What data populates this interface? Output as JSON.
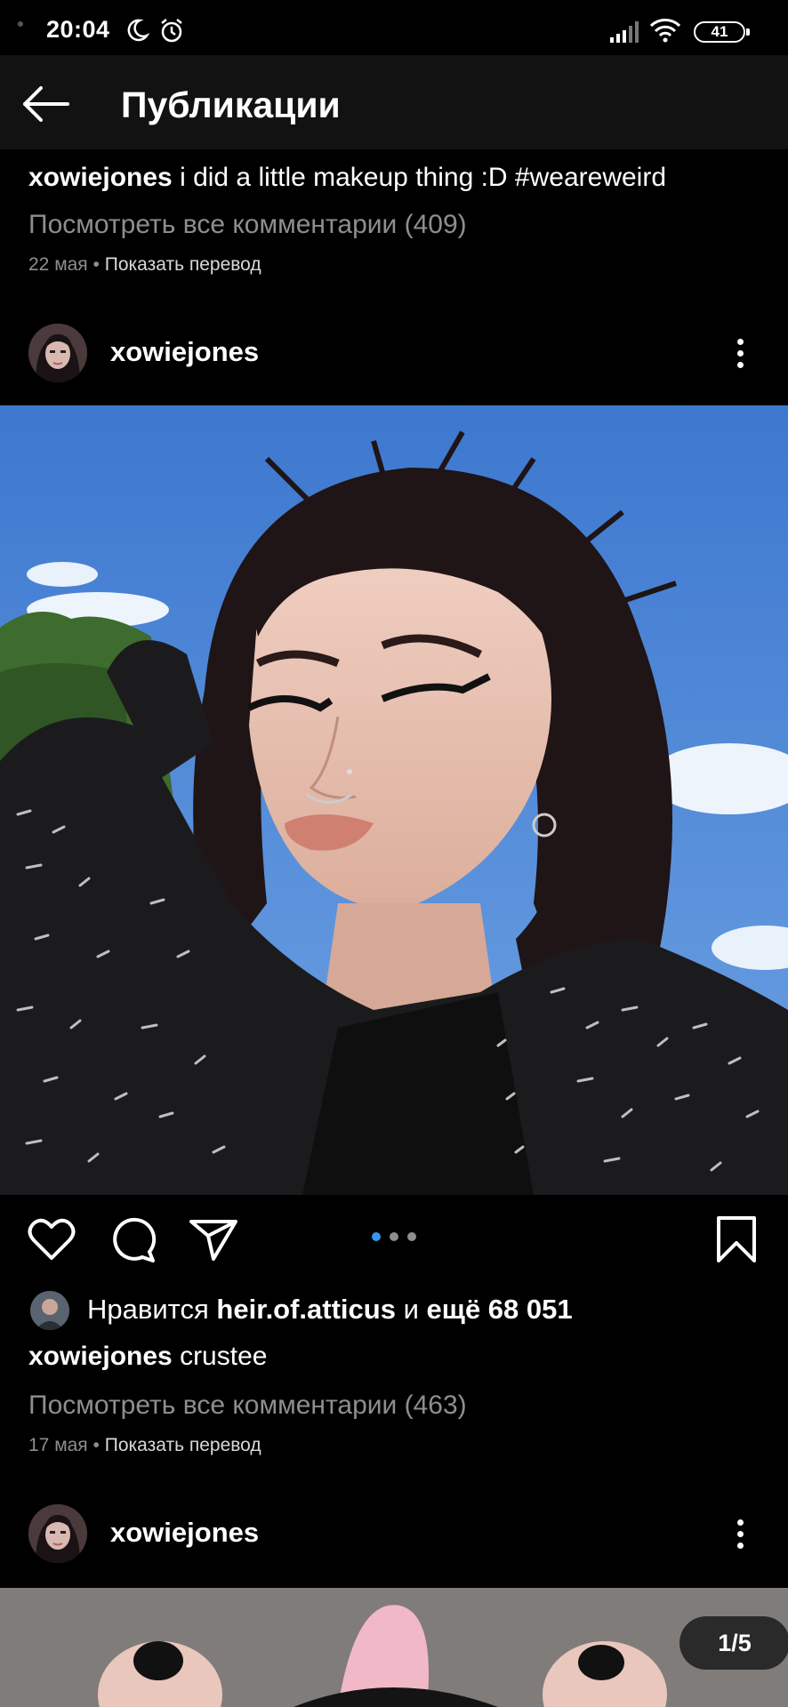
{
  "status_bar": {
    "time": "20:04",
    "battery": "41"
  },
  "app_bar": {
    "title": "Публикации"
  },
  "previous_post": {
    "username": "xowiejones",
    "caption": "i did a little makeup thing :D #weareweird",
    "comments_link": "Посмотреть все комментарии (409)",
    "date": "22 мая",
    "separator": "•",
    "translate": "Показать перевод"
  },
  "post": {
    "username": "xowiejones",
    "carousel_dots": 3,
    "active_dot": 0,
    "likes": {
      "prefix": "Нравится",
      "user": "heir.of.atticus",
      "and": "и",
      "more": "ещё 68 051"
    },
    "caption_user": "xowiejones",
    "caption": "crustee",
    "comments_link": "Посмотреть все комментарии (463)",
    "date": "17 мая",
    "separator": "•",
    "translate": "Показать перевод"
  },
  "next_post": {
    "username": "xowiejones",
    "counter": "1/5"
  },
  "colors": {
    "background": "#000000",
    "app_bar": "#121212",
    "secondary_text": "#8e8e8e",
    "active_dot": "#3897f0",
    "inactive_dot": "#8e8e8e"
  }
}
